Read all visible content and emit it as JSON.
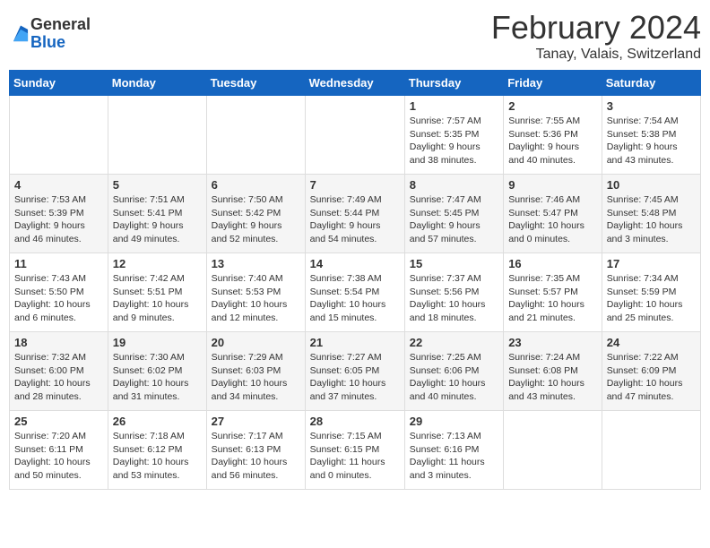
{
  "logo": {
    "general": "General",
    "blue": "Blue"
  },
  "title": "February 2024",
  "location": "Tanay, Valais, Switzerland",
  "days_of_week": [
    "Sunday",
    "Monday",
    "Tuesday",
    "Wednesday",
    "Thursday",
    "Friday",
    "Saturday"
  ],
  "weeks": [
    [
      {
        "day": "",
        "info": ""
      },
      {
        "day": "",
        "info": ""
      },
      {
        "day": "",
        "info": ""
      },
      {
        "day": "",
        "info": ""
      },
      {
        "day": "1",
        "info": "Sunrise: 7:57 AM\nSunset: 5:35 PM\nDaylight: 9 hours\nand 38 minutes."
      },
      {
        "day": "2",
        "info": "Sunrise: 7:55 AM\nSunset: 5:36 PM\nDaylight: 9 hours\nand 40 minutes."
      },
      {
        "day": "3",
        "info": "Sunrise: 7:54 AM\nSunset: 5:38 PM\nDaylight: 9 hours\nand 43 minutes."
      }
    ],
    [
      {
        "day": "4",
        "info": "Sunrise: 7:53 AM\nSunset: 5:39 PM\nDaylight: 9 hours\nand 46 minutes."
      },
      {
        "day": "5",
        "info": "Sunrise: 7:51 AM\nSunset: 5:41 PM\nDaylight: 9 hours\nand 49 minutes."
      },
      {
        "day": "6",
        "info": "Sunrise: 7:50 AM\nSunset: 5:42 PM\nDaylight: 9 hours\nand 52 minutes."
      },
      {
        "day": "7",
        "info": "Sunrise: 7:49 AM\nSunset: 5:44 PM\nDaylight: 9 hours\nand 54 minutes."
      },
      {
        "day": "8",
        "info": "Sunrise: 7:47 AM\nSunset: 5:45 PM\nDaylight: 9 hours\nand 57 minutes."
      },
      {
        "day": "9",
        "info": "Sunrise: 7:46 AM\nSunset: 5:47 PM\nDaylight: 10 hours\nand 0 minutes."
      },
      {
        "day": "10",
        "info": "Sunrise: 7:45 AM\nSunset: 5:48 PM\nDaylight: 10 hours\nand 3 minutes."
      }
    ],
    [
      {
        "day": "11",
        "info": "Sunrise: 7:43 AM\nSunset: 5:50 PM\nDaylight: 10 hours\nand 6 minutes."
      },
      {
        "day": "12",
        "info": "Sunrise: 7:42 AM\nSunset: 5:51 PM\nDaylight: 10 hours\nand 9 minutes."
      },
      {
        "day": "13",
        "info": "Sunrise: 7:40 AM\nSunset: 5:53 PM\nDaylight: 10 hours\nand 12 minutes."
      },
      {
        "day": "14",
        "info": "Sunrise: 7:38 AM\nSunset: 5:54 PM\nDaylight: 10 hours\nand 15 minutes."
      },
      {
        "day": "15",
        "info": "Sunrise: 7:37 AM\nSunset: 5:56 PM\nDaylight: 10 hours\nand 18 minutes."
      },
      {
        "day": "16",
        "info": "Sunrise: 7:35 AM\nSunset: 5:57 PM\nDaylight: 10 hours\nand 21 minutes."
      },
      {
        "day": "17",
        "info": "Sunrise: 7:34 AM\nSunset: 5:59 PM\nDaylight: 10 hours\nand 25 minutes."
      }
    ],
    [
      {
        "day": "18",
        "info": "Sunrise: 7:32 AM\nSunset: 6:00 PM\nDaylight: 10 hours\nand 28 minutes."
      },
      {
        "day": "19",
        "info": "Sunrise: 7:30 AM\nSunset: 6:02 PM\nDaylight: 10 hours\nand 31 minutes."
      },
      {
        "day": "20",
        "info": "Sunrise: 7:29 AM\nSunset: 6:03 PM\nDaylight: 10 hours\nand 34 minutes."
      },
      {
        "day": "21",
        "info": "Sunrise: 7:27 AM\nSunset: 6:05 PM\nDaylight: 10 hours\nand 37 minutes."
      },
      {
        "day": "22",
        "info": "Sunrise: 7:25 AM\nSunset: 6:06 PM\nDaylight: 10 hours\nand 40 minutes."
      },
      {
        "day": "23",
        "info": "Sunrise: 7:24 AM\nSunset: 6:08 PM\nDaylight: 10 hours\nand 43 minutes."
      },
      {
        "day": "24",
        "info": "Sunrise: 7:22 AM\nSunset: 6:09 PM\nDaylight: 10 hours\nand 47 minutes."
      }
    ],
    [
      {
        "day": "25",
        "info": "Sunrise: 7:20 AM\nSunset: 6:11 PM\nDaylight: 10 hours\nand 50 minutes."
      },
      {
        "day": "26",
        "info": "Sunrise: 7:18 AM\nSunset: 6:12 PM\nDaylight: 10 hours\nand 53 minutes."
      },
      {
        "day": "27",
        "info": "Sunrise: 7:17 AM\nSunset: 6:13 PM\nDaylight: 10 hours\nand 56 minutes."
      },
      {
        "day": "28",
        "info": "Sunrise: 7:15 AM\nSunset: 6:15 PM\nDaylight: 11 hours\nand 0 minutes."
      },
      {
        "day": "29",
        "info": "Sunrise: 7:13 AM\nSunset: 6:16 PM\nDaylight: 11 hours\nand 3 minutes."
      },
      {
        "day": "",
        "info": ""
      },
      {
        "day": "",
        "info": ""
      }
    ]
  ]
}
